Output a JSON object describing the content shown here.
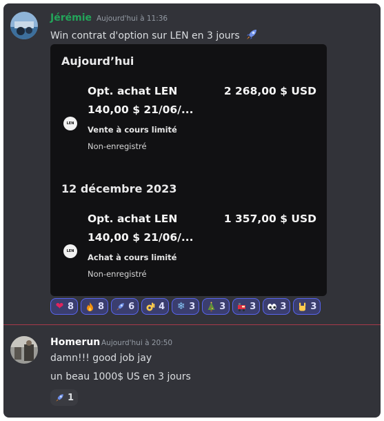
{
  "message1": {
    "author": "Jérémie",
    "author_color": "#23a55a",
    "timestamp": "Aujourd'hui à 11:36",
    "text": "Win contrat d'option sur LEN en 3 jours",
    "text_emoji": "rocket-icon",
    "embed": {
      "sections": [
        {
          "date": "Aujourd’hui",
          "ticker_icon": "LEN",
          "title": "Opt. achat LEN",
          "amount": "2 268,00 $  USD",
          "strike": "140,00 $  21/06/...",
          "kind": "Vente à cours limité",
          "status": "Non-enregistré"
        },
        {
          "date": "12 décembre 2023",
          "ticker_icon": "LEN",
          "title": "Opt. achat LEN",
          "amount": "1 357,00 $  USD",
          "strike": "140,00 $  21/06/...",
          "kind": "Achat à cours limité",
          "status": "Non-enregistré"
        }
      ]
    },
    "reactions": [
      {
        "emoji": "heart-icon",
        "glyph": "❤",
        "count": "8"
      },
      {
        "emoji": "fire-icon",
        "glyph": "🔥",
        "count": "8"
      },
      {
        "emoji": "rocket-icon",
        "glyph": "🚀",
        "count": "6"
      },
      {
        "emoji": "ok-hand-icon",
        "glyph": "👌",
        "count": "4"
      },
      {
        "emoji": "snowflake-icon",
        "glyph": "❄",
        "count": "3"
      },
      {
        "emoji": "christmas-tree-icon",
        "glyph": "🎄",
        "count": "3"
      },
      {
        "emoji": "train-icon",
        "glyph": "🚂",
        "count": "3"
      },
      {
        "emoji": "eyes-icon",
        "glyph": "👀",
        "count": "3"
      },
      {
        "emoji": "rock-on-hand-icon",
        "glyph": "🤘",
        "count": "3"
      }
    ]
  },
  "message2": {
    "author": "Homerun",
    "author_color": "#ffffff",
    "timestamp": "Aujourd'hui à 20:50",
    "lines": [
      "damn!!! good job jay",
      "un beau 1000$ US en 3 jours"
    ],
    "reactions": [
      {
        "emoji": "rocket-icon",
        "glyph": "🚀",
        "count": "1"
      }
    ]
  },
  "colors": {
    "background": "#323339",
    "embed": "#111113",
    "reaction_active_border": "#5865f2",
    "new_messages_divider": "#a8394a"
  }
}
